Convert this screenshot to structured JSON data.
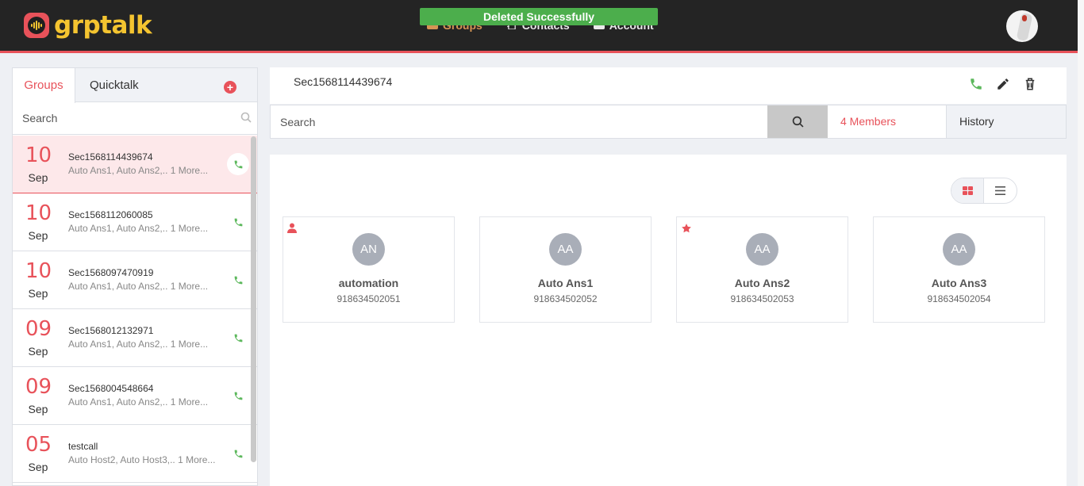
{
  "app": {
    "logo_text": "grptalk"
  },
  "nav": {
    "items": [
      {
        "label": "Groups",
        "icon": "groups-icon",
        "active": true
      },
      {
        "label": "Contacts",
        "icon": "contacts-icon",
        "active": false
      },
      {
        "label": "Account",
        "icon": "account-icon",
        "active": false
      }
    ]
  },
  "toast": {
    "message": "Deleted Successfully"
  },
  "left_panel": {
    "tabs": {
      "groups": "Groups",
      "quicktalk": "Quicktalk"
    },
    "search_placeholder": "Search",
    "groups": [
      {
        "day": "10",
        "month": "Sep",
        "name": "Sec1568114439674",
        "members": "Auto Ans1, Auto Ans2,.. 1 More...",
        "active": true
      },
      {
        "day": "10",
        "month": "Sep",
        "name": "Sec1568112060085",
        "members": "Auto Ans1, Auto Ans2,.. 1 More...",
        "active": false
      },
      {
        "day": "10",
        "month": "Sep",
        "name": "Sec1568097470919",
        "members": "Auto Ans1, Auto Ans2,.. 1 More...",
        "active": false
      },
      {
        "day": "09",
        "month": "Sep",
        "name": "Sec1568012132971",
        "members": "Auto Ans1, Auto Ans2,.. 1 More...",
        "active": false
      },
      {
        "day": "09",
        "month": "Sep",
        "name": "Sec1568004548664",
        "members": "Auto Ans1, Auto Ans2,.. 1 More...",
        "active": false
      },
      {
        "day": "05",
        "month": "Sep",
        "name": "testcall",
        "members": "Auto Host2, Auto Host3,.. 1 More...",
        "active": false
      }
    ]
  },
  "group_detail": {
    "title": "Sec1568114439674",
    "search_placeholder": "Search",
    "members_label": "4 Members",
    "history_label": "History",
    "members": [
      {
        "initials": "AN",
        "name": "automation",
        "phone": "918634502051",
        "badge": "person-icon"
      },
      {
        "initials": "AA",
        "name": "Auto Ans1",
        "phone": "918634502052",
        "badge": ""
      },
      {
        "initials": "AA",
        "name": "Auto Ans2",
        "phone": "918634502053",
        "badge": "star-icon"
      },
      {
        "initials": "AA",
        "name": "Auto Ans3",
        "phone": "918634502054",
        "badge": ""
      }
    ]
  },
  "colors": {
    "accent": "#e8525a",
    "call_green": "#5cb85c",
    "toast_green": "#4cae4c",
    "logo_yellow": "#f4c430"
  }
}
